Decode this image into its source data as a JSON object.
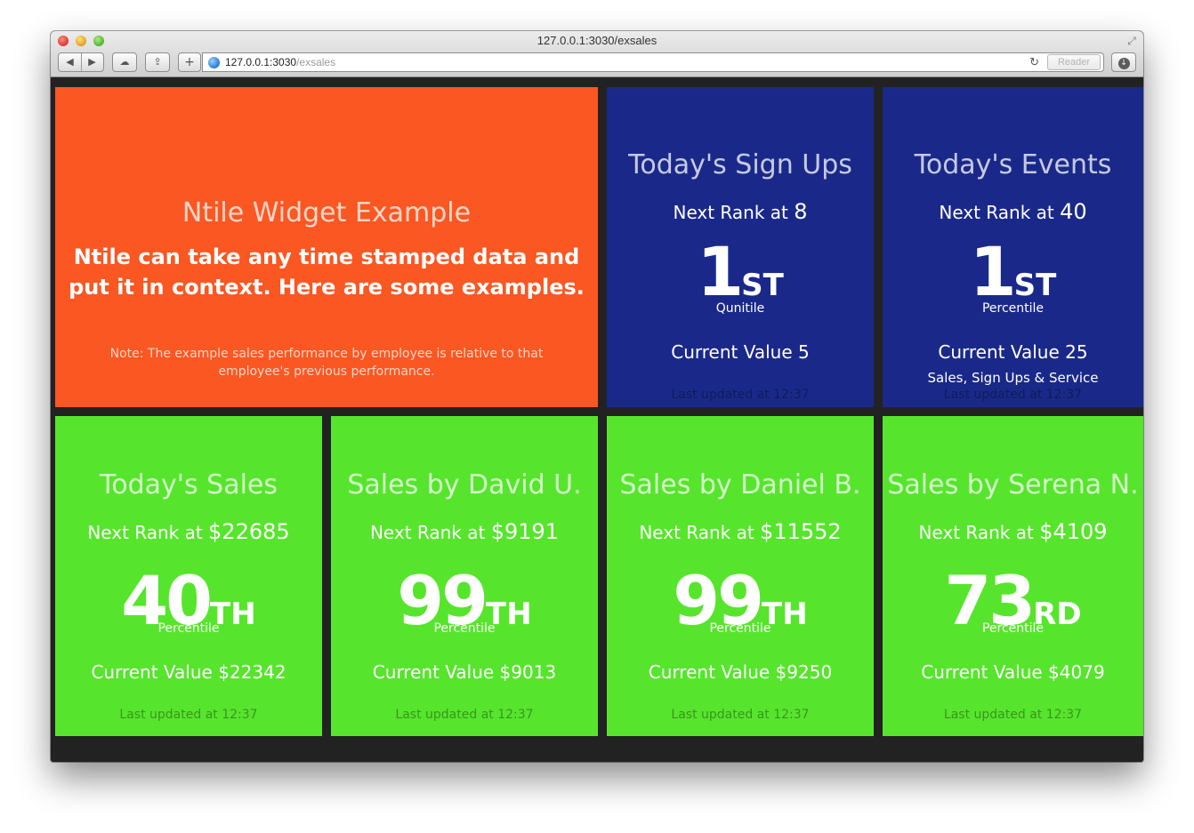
{
  "browser": {
    "window_title": "127.0.0.1:3030/exsales",
    "url_host": "127.0.0.1:3030",
    "url_path": "/exsales",
    "reader_label": "Reader"
  },
  "intro": {
    "title": "Ntile Widget Example",
    "text": "Ntile can take any time stamped data and put it in context. Here are some examples.",
    "note": "Note: The example sales performance by employee is relative to that employee's previous performance."
  },
  "widgets": [
    {
      "title": "Today's Sign Ups",
      "next_prefix": "Next Rank at ",
      "next_value": "8",
      "rank": "1",
      "suffix": "ST",
      "rank_label": "Qunitile",
      "current": "Current Value 5",
      "extra": "",
      "updated": "Last updated at 12:37",
      "color": "#1a2989"
    },
    {
      "title": "Today's Events",
      "next_prefix": "Next Rank at ",
      "next_value": "40",
      "rank": "1",
      "suffix": "ST",
      "rank_label": "Percentile",
      "current": "Current Value 25",
      "extra": "Sales, Sign Ups & Service",
      "updated": "Last updated at 12:37",
      "color": "#1a2989"
    },
    {
      "title": "Today's Sales",
      "next_prefix": "Next Rank at ",
      "next_value": "$22685",
      "rank": "40",
      "suffix": "TH",
      "rank_label": "Percentile",
      "current": "Current Value $22342",
      "extra": "",
      "updated": "Last updated at 12:37",
      "color": "#56e52c"
    },
    {
      "title": "Sales by David U.",
      "next_prefix": "Next Rank at ",
      "next_value": "$9191",
      "rank": "99",
      "suffix": "TH",
      "rank_label": "Percentile",
      "current": "Current Value $9013",
      "extra": "",
      "updated": "Last updated at 12:37",
      "color": "#56e52c"
    },
    {
      "title": "Sales by Daniel B.",
      "next_prefix": "Next Rank at ",
      "next_value": "$11552",
      "rank": "99",
      "suffix": "TH",
      "rank_label": "Percentile",
      "current": "Current Value $9250",
      "extra": "",
      "updated": "Last updated at 12:37",
      "color": "#56e52c"
    },
    {
      "title": "Sales by Serena N.",
      "next_prefix": "Next Rank at ",
      "next_value": "$4109",
      "rank": "73",
      "suffix": "RD",
      "rank_label": "Percentile",
      "current": "Current Value $4079",
      "extra": "",
      "updated": "Last updated at 12:37",
      "color": "#56e52c"
    }
  ],
  "colors": {
    "intro": "#fa5722",
    "blue": "#1a2989",
    "green": "#56e52c",
    "background": "#222222"
  }
}
